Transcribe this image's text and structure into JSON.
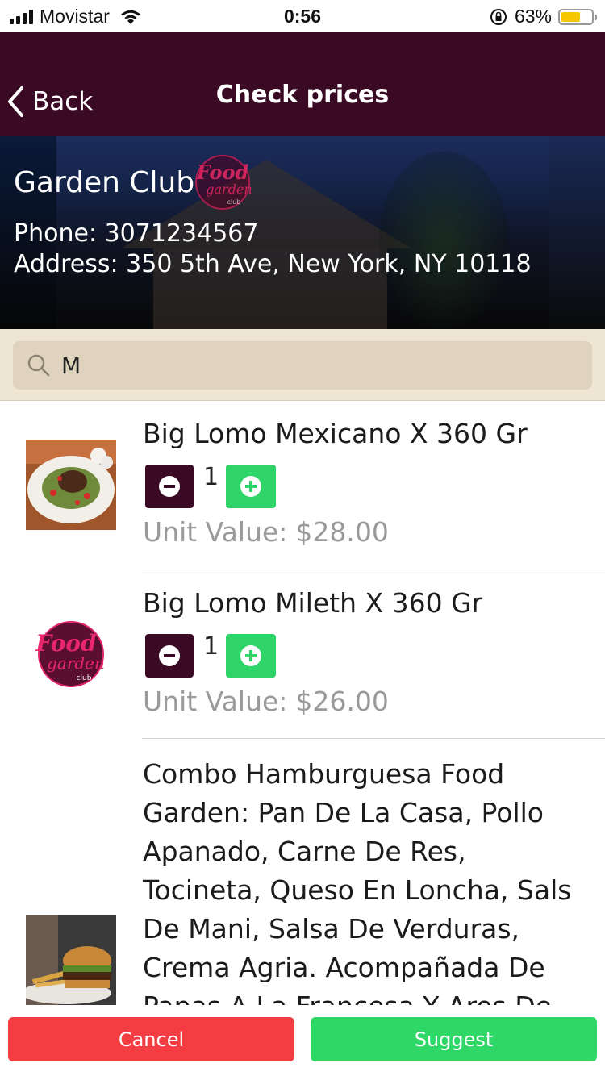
{
  "status_bar": {
    "carrier": "Movistar",
    "time": "0:56",
    "battery_percent": "63%",
    "battery_level": 0.63,
    "battery_color": "#f7c600"
  },
  "nav": {
    "back_label": "Back",
    "title": "Check prices"
  },
  "store": {
    "name": "Garden Club",
    "phone_label": "Phone:",
    "phone": "3071234567",
    "address_label": "Address:",
    "address": "350 5th Ave, New York, NY 10118",
    "logo_text_1": "Food",
    "logo_text_2": "garden",
    "logo_text_3": "club"
  },
  "search": {
    "value": "M",
    "icon": "search-icon"
  },
  "products": [
    {
      "name": "Big Lomo Mexicano X 360 Gr",
      "quantity": "1",
      "unit_label": "Unit Value:",
      "unit_value": "$28.00",
      "image": "steak-salad-photo"
    },
    {
      "name": "Big Lomo Mileth X 360 Gr",
      "quantity": "1",
      "unit_label": "Unit Value:",
      "unit_value": "$26.00",
      "image": "food-garden-logo"
    },
    {
      "name": "Combo Hamburguesa Food Garden: Pan De La Casa, Pollo Apanado, Carne De Res, Tocineta, Queso En Loncha, Sals De Mani, Salsa De Verduras, Crema Agria. Acompañada De Papas A La Francesa Y Aros De",
      "image": "burger-photo"
    }
  ],
  "buttons": {
    "cancel": "Cancel",
    "suggest": "Suggest"
  },
  "colors": {
    "primary": "#3a0a25",
    "plus": "#2ed467",
    "cancel": "#f43d42",
    "suggest": "#2fd866",
    "search_bg": "#efe5d3"
  }
}
